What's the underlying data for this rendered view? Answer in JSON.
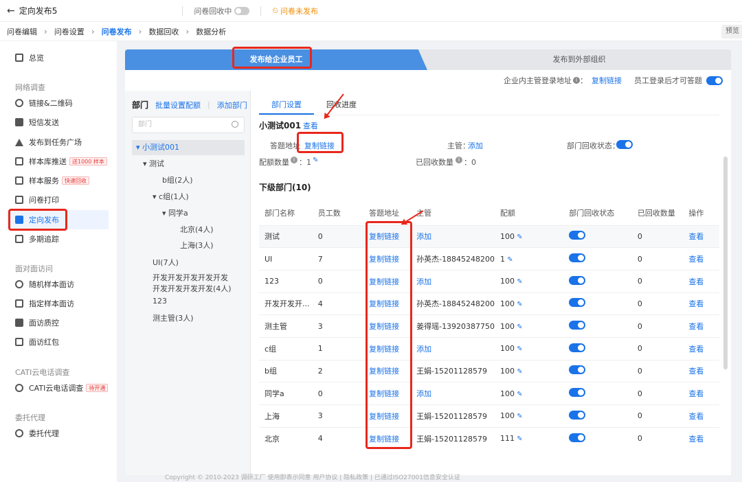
{
  "header": {
    "back_icon": "arrow-left-icon",
    "title": "定向发布5",
    "recv_label": "问卷回收中",
    "unpub_label": "问卷未发布"
  },
  "steps": [
    "问卷编辑",
    "问卷设置",
    "问卷发布",
    "数据回收",
    "数据分析"
  ],
  "preview": "预览",
  "sidebar": {
    "overview": "总览",
    "sec1": "网络调查",
    "items1": [
      "链接&二维码",
      "短信发送",
      "发布到任务广场",
      "样本库推送",
      "样本服务",
      "问卷打印",
      "定向发布",
      "多期追踪"
    ],
    "badge_push": "送1000 样本",
    "badge_service": "快速回收",
    "sec2": "面对面访问",
    "items2": [
      "随机样本面访",
      "指定样本面访",
      "面访质控",
      "面访红包"
    ],
    "sec3": "CATI云电话调查",
    "items3": [
      "CATI云电话调查"
    ],
    "badge_cati": "待开通",
    "sec4": "委托代理",
    "items4": [
      "委托代理"
    ]
  },
  "tabs": {
    "internal": "发布给企业员工",
    "external": "发布到外部组织"
  },
  "infobar": {
    "login_label": "企业内主管登录地址",
    "colon": "：",
    "copy": "复制链接",
    "after_login": "员工登录后才可答题"
  },
  "dept": {
    "title": "部门",
    "batch": "批量设置配额",
    "add": "添加部门",
    "placeholder": "部门",
    "tree": [
      "小测试001",
      "测试",
      "b组(2人)",
      "c组(1人)",
      "同学a",
      "北京(4人)",
      "上海(3人)",
      "UI(7人)",
      "开发开发开发开发开发",
      "开发开发开发开发(4人)",
      "123",
      "测主管(3人)"
    ]
  },
  "panel": {
    "tab_set": "部门设置",
    "tab_prog": "回收进度",
    "name": "小测试001",
    "view": "查看",
    "addr_label": "答题地址",
    "copy": "复制链接",
    "mgr_label": "主管：",
    "mgr_add": "添加",
    "state_label": "部门回收状态：",
    "quota_label": "配额数量",
    "quota_colon": "：1",
    "recv_label": "已回收数量",
    "recv_colon": "：0",
    "sub_title": "下级部门(10)",
    "cols": [
      "部门名称",
      "员工数",
      "答题地址",
      "主管",
      "配额",
      "部门回收状态",
      "已回收数量",
      "操作"
    ],
    "rows": [
      [
        "测试",
        "0",
        "复制链接",
        "添加",
        "100",
        "0",
        "查看"
      ],
      [
        "UI",
        "7",
        "复制链接",
        "孙英杰-18845248200",
        "1",
        "0",
        "查看"
      ],
      [
        "123",
        "0",
        "复制链接",
        "添加",
        "100",
        "0",
        "查看"
      ],
      [
        "开发开发开...",
        "4",
        "复制链接",
        "孙英杰-18845248200",
        "100",
        "0",
        "查看"
      ],
      [
        "测主管",
        "3",
        "复制链接",
        "姜得瑶-13920387750",
        "100",
        "0",
        "查看"
      ],
      [
        "c组",
        "1",
        "复制链接",
        "添加",
        "100",
        "0",
        "查看"
      ],
      [
        "b组",
        "2",
        "复制链接",
        "王娟-15201128579",
        "100",
        "0",
        "查看"
      ],
      [
        "同学a",
        "0",
        "复制链接",
        "添加",
        "100",
        "0",
        "查看"
      ],
      [
        "上海",
        "3",
        "复制链接",
        "王娟-15201128579",
        "100",
        "0",
        "查看"
      ],
      [
        "北京",
        "4",
        "复制链接",
        "王娟-15201128579",
        "111",
        "0",
        "查看"
      ]
    ]
  },
  "footer": "Copyright © 2010-2023 调研工厂 使用即表示同意 用户协议 | 隐私政策 | 已通过ISO27001信息安全认证",
  "colors": {
    "accent": "#1a73e8",
    "highlight": "#e8271b"
  }
}
